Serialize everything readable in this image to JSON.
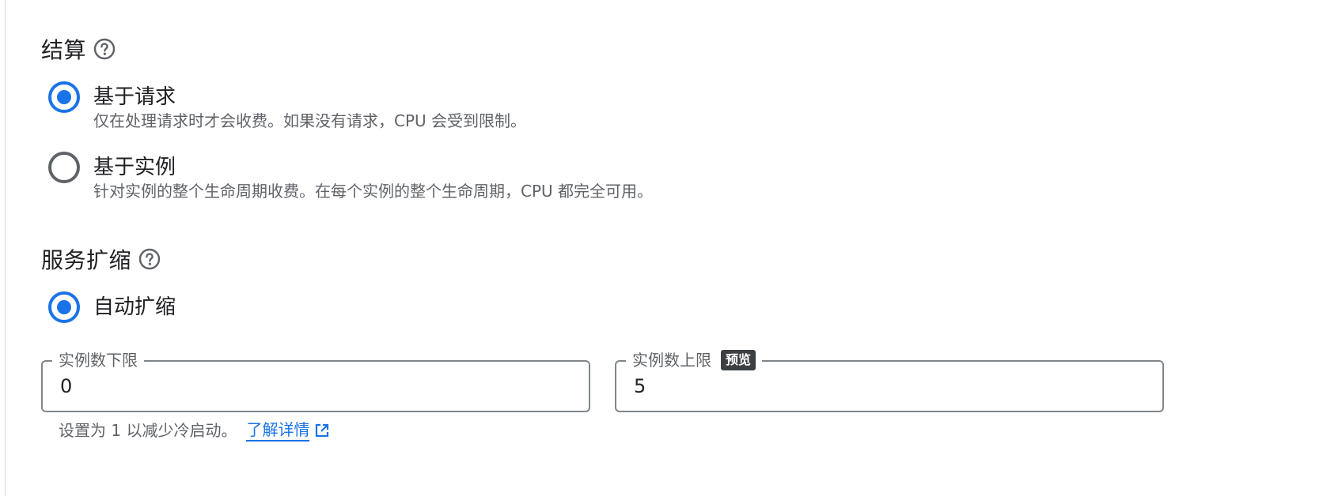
{
  "billing": {
    "title": "结算",
    "options": [
      {
        "label": "基于请求",
        "description": "仅在处理请求时才会收费。如果没有请求，CPU 会受到限制。",
        "selected": true
      },
      {
        "label": "基于实例",
        "description": "针对实例的整个生命周期收费。在每个实例的整个生命周期，CPU 都完全可用。",
        "selected": false
      }
    ]
  },
  "scaling": {
    "title": "服务扩缩",
    "options": [
      {
        "label": "自动扩缩",
        "selected": true
      }
    ],
    "min_instances": {
      "label": "实例数下限",
      "value": "0"
    },
    "max_instances": {
      "label": "实例数上限",
      "badge": "预览",
      "value": "5"
    },
    "hint": "设置为 1 以减少冷启动。",
    "learn_more": "了解详情"
  },
  "icons": {
    "help": "help-circle-icon",
    "external": "open-in-new-icon"
  },
  "colors": {
    "accent": "#1a73e8",
    "text": "#202124",
    "secondary_text": "#5f6368",
    "badge_bg": "#3c4043",
    "field_border": "#80868b"
  }
}
